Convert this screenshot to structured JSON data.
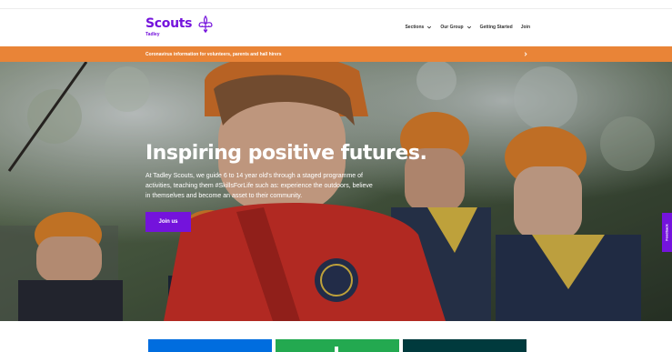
{
  "brand": {
    "name": "Scouts",
    "sub": "Tadley",
    "logo_icon": "fleur-de-lis-icon",
    "color": "#7413dc"
  },
  "nav": {
    "items": [
      {
        "label": "Sections",
        "dropdown": true
      },
      {
        "label": "Our Group",
        "dropdown": true
      },
      {
        "label": "Getting Started",
        "dropdown": false
      },
      {
        "label": "Join",
        "dropdown": false
      }
    ]
  },
  "banner": {
    "text": "Coronavirus information for volunteers, parents and hall hirers",
    "arrow_icon": "chevron-right-icon",
    "color": "#e98437"
  },
  "hero": {
    "title": "Inspiring positive futures.",
    "body": "At Tadley Scouts, we guide 6 to 14 year old's through a staged programme of activities, teaching them #SkillsForLife such as: experience the outdoors, believe in themselves and become an asset to their community.",
    "cta_label": "Join us"
  },
  "feedback": {
    "label": "Feedback"
  },
  "cards": {
    "colors": [
      "#006ddf",
      "#23a950",
      "#003a3d"
    ]
  }
}
